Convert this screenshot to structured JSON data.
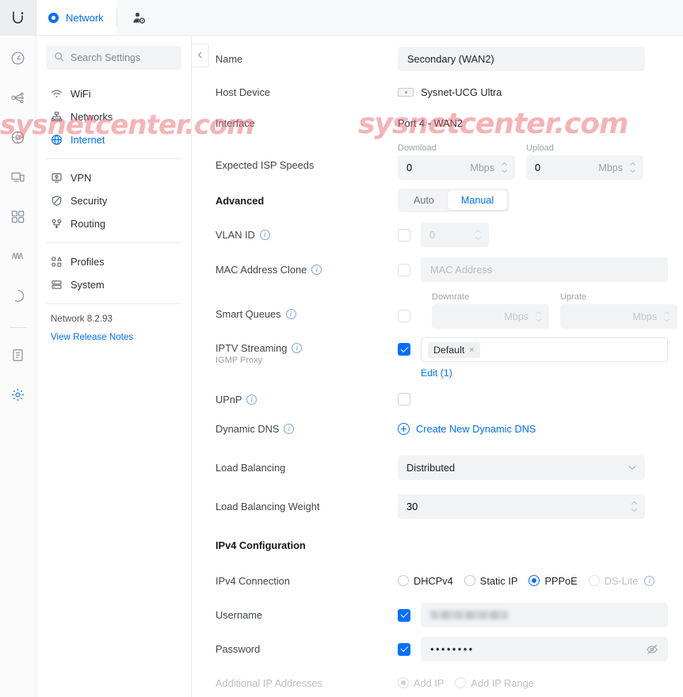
{
  "topbar": {
    "brand_icon": "ubiquiti-logo-icon",
    "tab_label": "Network",
    "tab_icon": "network-dot-icon",
    "admin_icon": "user-admin-icon"
  },
  "rail": {
    "items": [
      {
        "name": "dashboard",
        "icon": "gauge-icon"
      },
      {
        "name": "topology",
        "icon": "topology-icon"
      },
      {
        "name": "internet",
        "icon": "target-internet-icon"
      },
      {
        "name": "devices",
        "icon": "devices-icon"
      },
      {
        "name": "clients",
        "icon": "clients-icon"
      },
      {
        "name": "insights",
        "icon": "insights-wave-icon"
      },
      {
        "name": "wifiman",
        "icon": "circle-icon"
      },
      {
        "name": "logs",
        "icon": "clipboard-logs-icon"
      },
      {
        "name": "settings",
        "icon": "gear-icon"
      }
    ]
  },
  "settings_panel": {
    "search_placeholder": "Search Settings",
    "search_icon": "search-icon",
    "groups": [
      {
        "items": [
          {
            "label": "WiFi",
            "icon": "wifi-icon",
            "active": false
          },
          {
            "label": "Networks",
            "icon": "networks-icon",
            "active": false
          },
          {
            "label": "Internet",
            "icon": "globe-icon",
            "active": true
          }
        ]
      },
      {
        "items": [
          {
            "label": "VPN",
            "icon": "vpn-icon",
            "active": false
          },
          {
            "label": "Security",
            "icon": "shield-icon",
            "active": false
          },
          {
            "label": "Routing",
            "icon": "routing-icon",
            "active": false
          }
        ]
      },
      {
        "items": [
          {
            "label": "Profiles",
            "icon": "profiles-icon",
            "active": false
          },
          {
            "label": "System",
            "icon": "system-icon",
            "active": false
          }
        ]
      }
    ],
    "version": "Network 8.2.93",
    "release_notes": "View Release Notes"
  },
  "form": {
    "collapse_icon": "chevron-left-icon",
    "name": {
      "label": "Name",
      "value": "Secondary (WAN2)"
    },
    "host_device": {
      "label": "Host Device",
      "value": "Sysnet-UCG Ultra",
      "icon": "device-thumb-icon"
    },
    "interface": {
      "label": "Interface",
      "value": "Port 4 - WAN2"
    },
    "isp_speeds": {
      "label": "Expected ISP Speeds",
      "download_label": "Download",
      "download_value": "0",
      "download_unit": "Mbps",
      "upload_label": "Upload",
      "upload_value": "0",
      "upload_unit": "Mbps"
    },
    "advanced": {
      "label": "Advanced",
      "options": [
        "Auto",
        "Manual"
      ],
      "selected": "Manual"
    },
    "vlan_id": {
      "label": "VLAN ID",
      "checked": false,
      "value": "0",
      "info_icon": "info-icon"
    },
    "mac_clone": {
      "label": "MAC Address Clone",
      "checked": false,
      "placeholder": "MAC Address",
      "info_icon": "info-icon"
    },
    "smart_queues": {
      "label": "Smart Queues",
      "checked": false,
      "info_icon": "info-icon",
      "downrate_label": "Downrate",
      "downrate_value": "",
      "downrate_unit": "Mbps",
      "uprate_label": "Uprate",
      "uprate_value": "",
      "uprate_unit": "Mbps"
    },
    "iptv": {
      "label": "IPTV Streaming",
      "sublabel": "IGMP Proxy",
      "checked": true,
      "tag": "Default",
      "tag_remove": "×",
      "edit_link": "Edit (1)",
      "info_icon": "info-icon"
    },
    "upnp": {
      "label": "UPnP",
      "checked": false,
      "info_icon": "info-icon"
    },
    "dynamic_dns": {
      "label": "Dynamic DNS",
      "link": "Create New Dynamic DNS",
      "info_icon": "info-icon",
      "add_icon": "plus-circle-icon"
    },
    "load_balancing": {
      "label": "Load Balancing",
      "value": "Distributed",
      "chevron": "chevron-down-icon"
    },
    "load_balancing_weight": {
      "label": "Load Balancing Weight",
      "value": "30"
    },
    "ipv4_heading": "IPv4 Configuration",
    "ipv4_connection": {
      "label": "IPv4 Connection",
      "options": [
        {
          "label": "DHCPv4",
          "selected": false,
          "disabled": false
        },
        {
          "label": "Static IP",
          "selected": false,
          "disabled": false
        },
        {
          "label": "PPPoE",
          "selected": true,
          "disabled": false
        },
        {
          "label": "DS-Lite",
          "selected": false,
          "disabled": true
        }
      ],
      "info_icon": "info-icon"
    },
    "username": {
      "label": "Username",
      "checked": true,
      "value": ""
    },
    "password": {
      "label": "Password",
      "checked": true,
      "value": "••••••••",
      "eye_icon": "eye-off-icon"
    },
    "additional_ips": {
      "label": "Additional IP Addresses",
      "options": [
        {
          "label": "Add IP",
          "selected": true
        },
        {
          "label": "Add IP Range",
          "selected": false
        }
      ]
    }
  },
  "watermarks": {
    "left": "sysnetcenter.com",
    "right": "sysnetcenter.com"
  },
  "colors": {
    "accent": "#006fff",
    "panel_bg": "#f2f3f5",
    "text": "#1f2326"
  }
}
